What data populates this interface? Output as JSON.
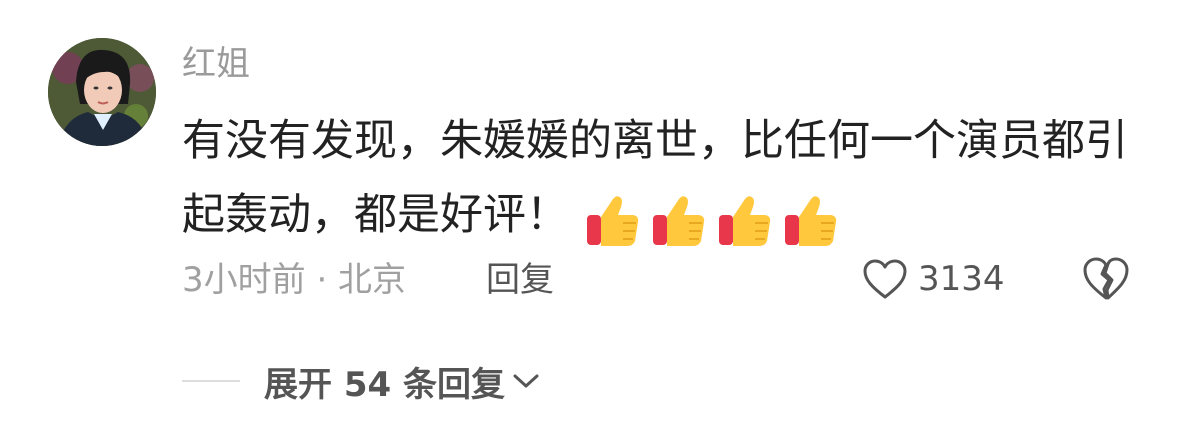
{
  "comment": {
    "username": "红姐",
    "text": "有没有发现，朱媛媛的离世，比任何一个演员都引起轰动，都是好评！",
    "emoji": [
      "thumbs-up-icon",
      "thumbs-up-icon",
      "thumbs-up-icon",
      "thumbs-up-icon"
    ],
    "time_location": "3小时前 · 北京",
    "reply_label": "回复",
    "like_count": "3134"
  },
  "replies": {
    "expand_label": "展开 54 条回复"
  },
  "colors": {
    "username": "#9a9a9a",
    "text": "#222222",
    "meta": "#a0a0a0",
    "action": "#555555",
    "thumb_yellow": "#ffc83d",
    "thumb_red": "#e8364a"
  }
}
